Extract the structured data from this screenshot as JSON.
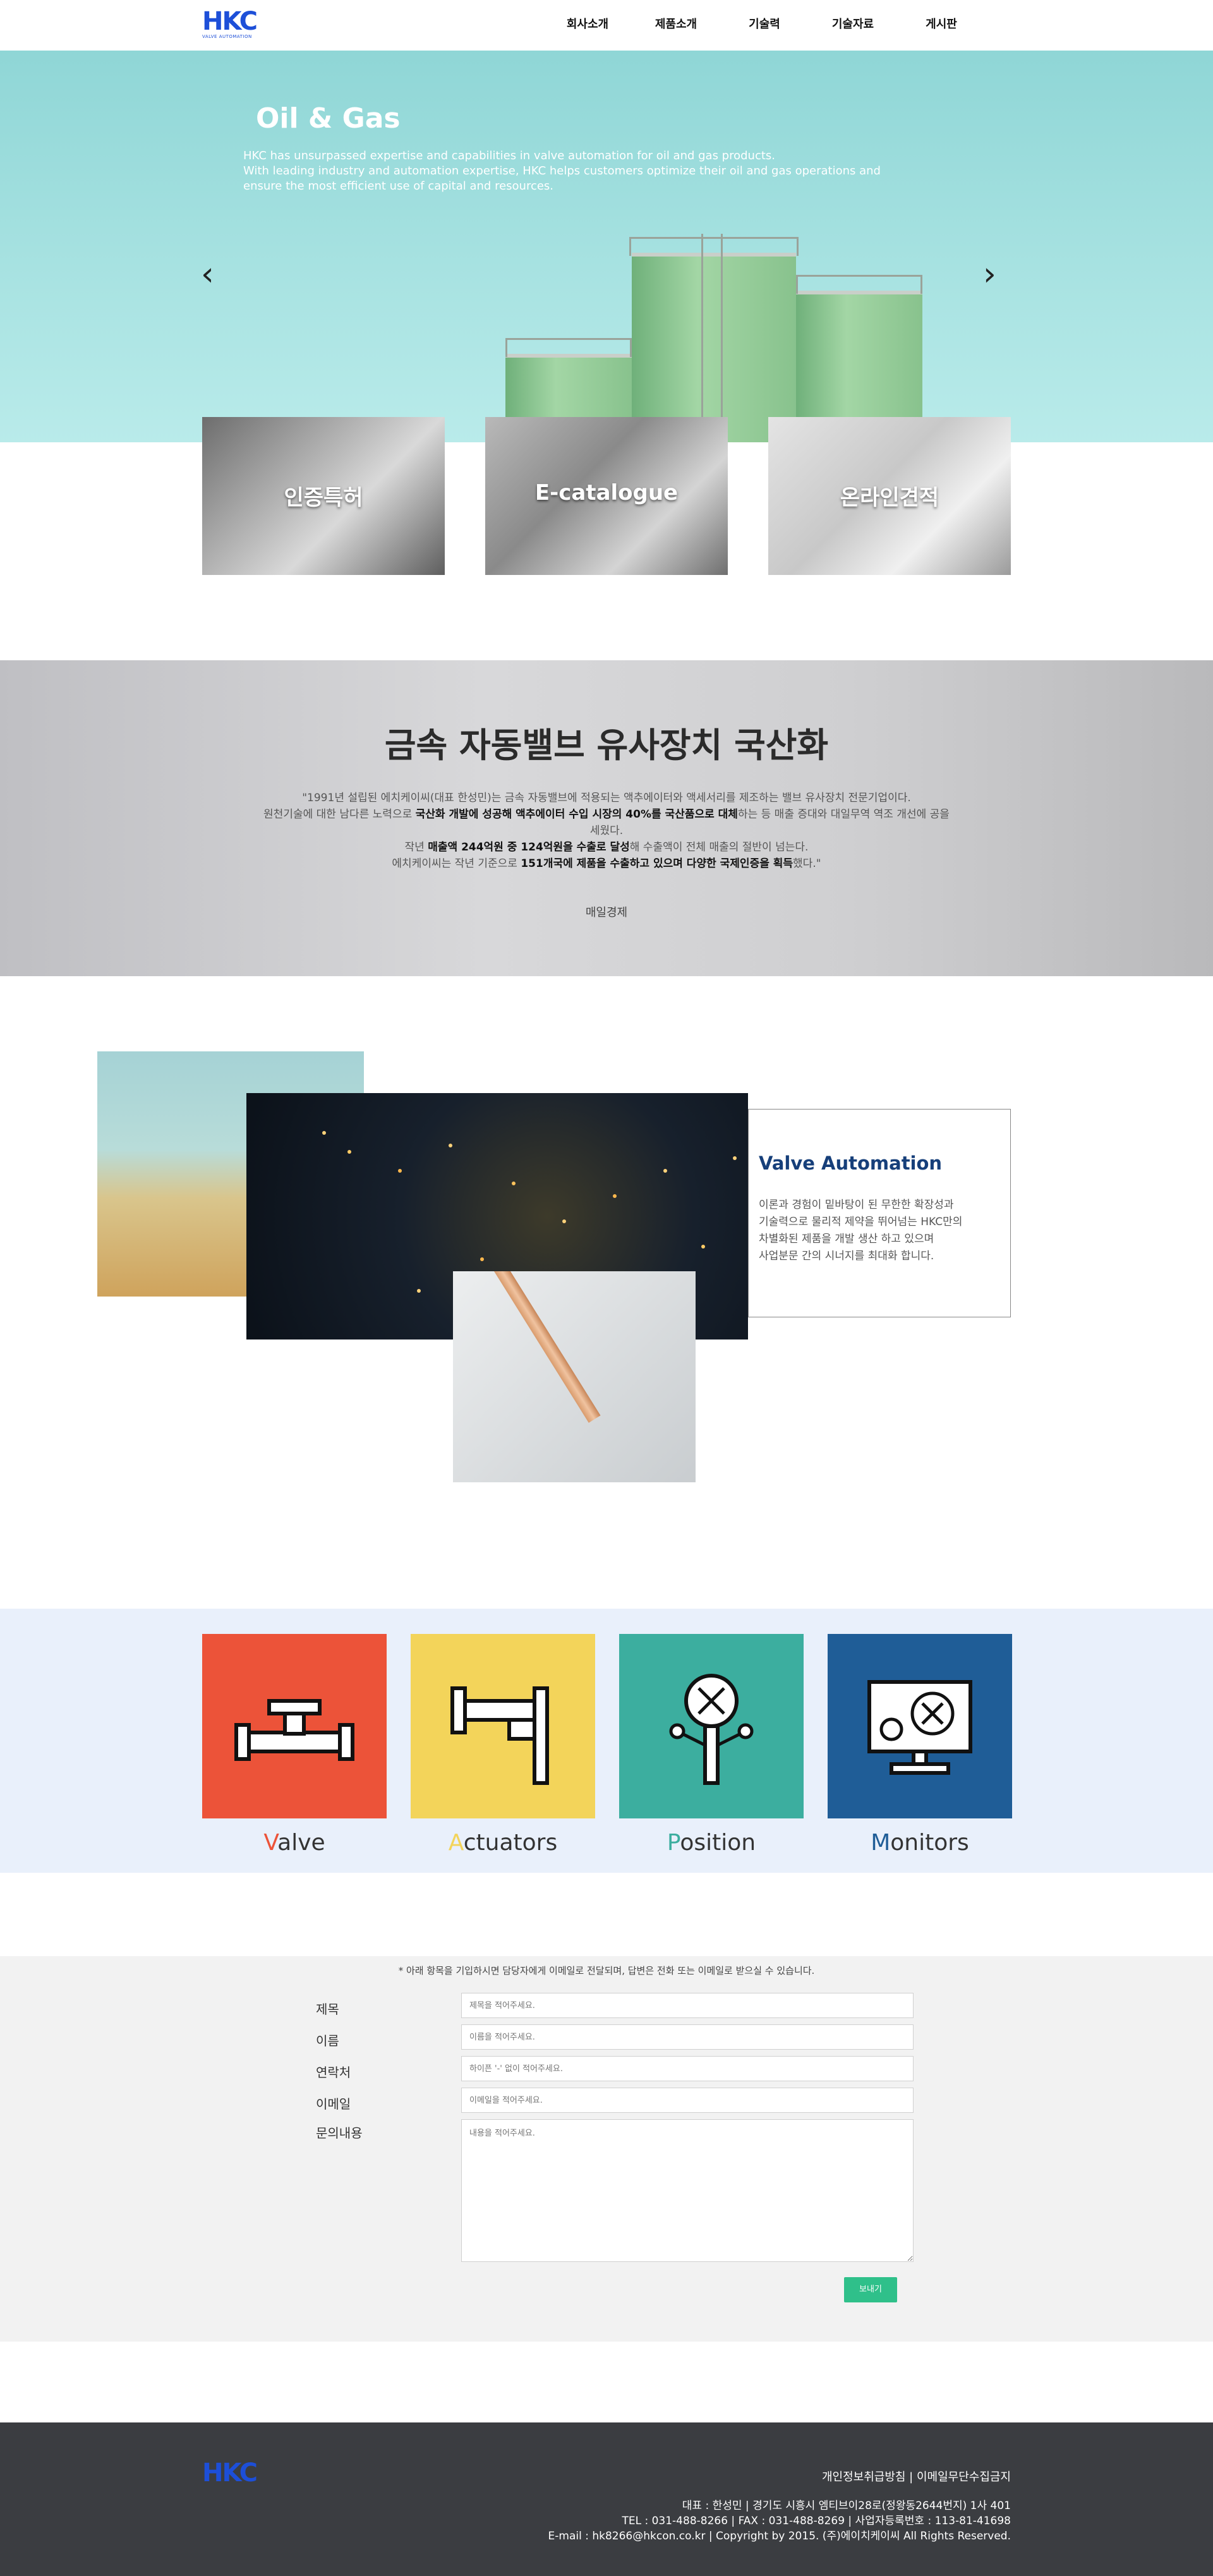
{
  "header": {
    "logo_text": "HKC",
    "logo_sub": "VALVE AUTOMATION",
    "nav": [
      "회사소개",
      "제품소개",
      "기술력",
      "기술자료",
      "게시판"
    ]
  },
  "hero": {
    "title": "Oil & Gas",
    "lines": [
      "HKC has unsurpassed expertise and capabilities in valve automation for oil and gas products.",
      "With leading industry and automation expertise, HKC helps customers optimize their oil and gas operations and",
      "ensure the most efficient use of capital and resources."
    ],
    "prev_icon": "chevron-left-icon",
    "next_icon": "chevron-right-icon"
  },
  "cards": [
    "인증특허",
    "E-catalogue",
    "온라인견적"
  ],
  "quote": {
    "title": "금속 자동밸브 유사장치 국산화",
    "line1": "\"1991년 설립된 에치케이씨(대표 한성민)는 금속 자동밸브에 적용되는 액추에이터와 액세서리를 제조하는 밸브 유사장치 전문기업이다.",
    "line2_a": "원천기술에 대한 남다른 노력으로 ",
    "line2_b": "국산화 개발에 성공해 액추에이터 수입 시장의 40%를 국산품으로 대체",
    "line2_c": "하는 등 매출 증대와 대일무역 역조 개선에 공을",
    "line3": "세웠다.",
    "line4_a": "작년 ",
    "line4_b": "매출액 244억원 중 124억원을 수출로 달성",
    "line4_c": "해 수출액이 전체 매출의 절반이 넘는다.",
    "line5_a": "에치케이씨는 작년 기준으로 ",
    "line5_b": "151개국에 제품을 수출하고 있으며 다양한 국제인증을 획득",
    "line5_c": "했다.\"",
    "source": "매일경제"
  },
  "valve_automation": {
    "title": "Valve Automation",
    "lines": [
      "이론과 경험이 밑바탕이 된 무한한 확장성과",
      "기술력으로 물리적 제약을 뛰어넘는 HKC만의",
      "차별화된 제품을 개발 생산 하고 있으며",
      "사업분문 간의 시너지를 최대화 합니다."
    ]
  },
  "products": [
    {
      "first": "V",
      "rest": "alve",
      "color": "#ec5339",
      "icon": "valve-icon"
    },
    {
      "first": "A",
      "rest": "ctuators",
      "color": "#f3d45a",
      "icon": "actuator-icon"
    },
    {
      "first": "P",
      "rest": "osition",
      "color": "#3cae9f",
      "icon": "position-icon"
    },
    {
      "first": "M",
      "rest": "onitors",
      "color": "#1f5d97",
      "icon": "monitor-icon"
    }
  ],
  "form": {
    "note": "* 아래 항목을 기입하시면 담당자에게 이메일로 전달되며, 답변은 전화 또는 이메일로 받으실 수 있습니다.",
    "fields": [
      {
        "label": "제목",
        "placeholder": "제목을 적어주세요."
      },
      {
        "label": "이름",
        "placeholder": "이름을 적어주세요."
      },
      {
        "label": "연락처",
        "placeholder": "하이픈 '-' 없이 적어주세요."
      },
      {
        "label": "이메일",
        "placeholder": "이메일을 적어주세요."
      },
      {
        "label": "문의내용",
        "placeholder": "내용을 적어주세요."
      }
    ],
    "submit": "보내기"
  },
  "footer": {
    "logo_text": "HKC",
    "links": "개인정보취급방침 | 이메일무단수집금지",
    "line1": "대표 : 한성민 | 경기도 시흥시 엠티브이28로(정왕동2644번지) 1사 401",
    "line2": "TEL : 031-488-8266 | FAX : 031-488-8269 | 사업자등록번호 : 113-81-41698",
    "line3": "E-mail : hk8266@hkcon.co.kr | Copyright by 2015. (주)에이치케이씨 All Rights Reserved."
  }
}
